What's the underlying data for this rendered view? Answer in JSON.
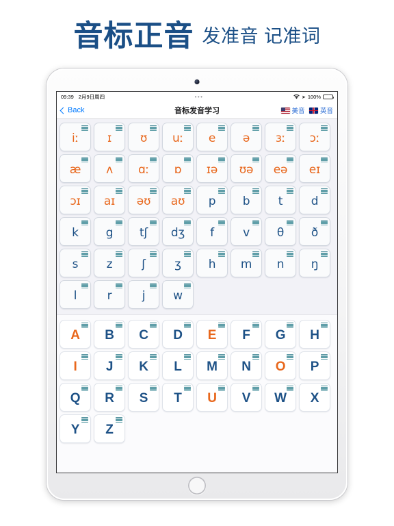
{
  "promo": {
    "main_title": "音标正音",
    "subtitle": "发准音 记准词"
  },
  "colors": {
    "brand_blue": "#1b4f86",
    "vowel_orange": "#e8671c",
    "consonant_blue": "#1d5186",
    "link_blue": "#007aff",
    "accent_blue": "#2b6cd4",
    "screen_bg": "#f2f2f7",
    "battery_green": "#34c759"
  },
  "status_bar": {
    "time": "09:39",
    "date": "2月9日周四",
    "multitask_dots": "•••",
    "wifi_icon": "wifi-icon",
    "location_icon": "location-icon",
    "battery_percent": "100%",
    "battery_icon": "battery-charging-icon"
  },
  "nav_bar": {
    "back_label": "Back",
    "back_icon": "chevron-left-icon",
    "title": "音标发音学习",
    "accents": [
      {
        "label": "美音",
        "flag": "us-flag-icon"
      },
      {
        "label": "英音",
        "flag": "uk-flag-icon"
      }
    ]
  },
  "phonetics": {
    "tile_icon": "list-icon",
    "rows": [
      [
        {
          "symbol": "iː",
          "type": "vowel"
        },
        {
          "symbol": "ɪ",
          "type": "vowel"
        },
        {
          "symbol": "ʊ",
          "type": "vowel"
        },
        {
          "symbol": "uː",
          "type": "vowel"
        },
        {
          "symbol": "e",
          "type": "vowel"
        },
        {
          "symbol": "ə",
          "type": "vowel"
        },
        {
          "symbol": "ɜː",
          "type": "vowel"
        },
        {
          "symbol": "ɔː",
          "type": "vowel"
        }
      ],
      [
        {
          "symbol": "æ",
          "type": "vowel"
        },
        {
          "symbol": "ʌ",
          "type": "vowel"
        },
        {
          "symbol": "ɑː",
          "type": "vowel"
        },
        {
          "symbol": "ɒ",
          "type": "vowel"
        },
        {
          "symbol": "ɪə",
          "type": "vowel"
        },
        {
          "symbol": "ʊə",
          "type": "vowel"
        },
        {
          "symbol": "eə",
          "type": "vowel"
        },
        {
          "symbol": "eɪ",
          "type": "vowel"
        }
      ],
      [
        {
          "symbol": "ɔɪ",
          "type": "vowel"
        },
        {
          "symbol": "aɪ",
          "type": "vowel"
        },
        {
          "symbol": "əʊ",
          "type": "vowel"
        },
        {
          "symbol": "aʊ",
          "type": "vowel"
        },
        {
          "symbol": "p",
          "type": "consonant"
        },
        {
          "symbol": "b",
          "type": "consonant"
        },
        {
          "symbol": "t",
          "type": "consonant"
        },
        {
          "symbol": "d",
          "type": "consonant"
        }
      ],
      [
        {
          "symbol": "k",
          "type": "consonant"
        },
        {
          "symbol": "g",
          "type": "consonant"
        },
        {
          "symbol": "tʃ",
          "type": "consonant"
        },
        {
          "symbol": "dʒ",
          "type": "consonant"
        },
        {
          "symbol": "f",
          "type": "consonant"
        },
        {
          "symbol": "v",
          "type": "consonant"
        },
        {
          "symbol": "θ",
          "type": "consonant"
        },
        {
          "symbol": "ð",
          "type": "consonant"
        }
      ],
      [
        {
          "symbol": "s",
          "type": "consonant"
        },
        {
          "symbol": "z",
          "type": "consonant"
        },
        {
          "symbol": "ʃ",
          "type": "consonant"
        },
        {
          "symbol": "ʒ",
          "type": "consonant"
        },
        {
          "symbol": "h",
          "type": "consonant"
        },
        {
          "symbol": "m",
          "type": "consonant"
        },
        {
          "symbol": "n",
          "type": "consonant"
        },
        {
          "symbol": "ŋ",
          "type": "consonant"
        }
      ],
      [
        {
          "symbol": "l",
          "type": "consonant"
        },
        {
          "symbol": "r",
          "type": "consonant"
        },
        {
          "symbol": "j",
          "type": "consonant"
        },
        {
          "symbol": "w",
          "type": "consonant"
        }
      ]
    ]
  },
  "alphabet": {
    "tile_icon": "list-icon",
    "rows": [
      [
        {
          "letter": "A",
          "type": "vowel"
        },
        {
          "letter": "B",
          "type": "consonant"
        },
        {
          "letter": "C",
          "type": "consonant"
        },
        {
          "letter": "D",
          "type": "consonant"
        },
        {
          "letter": "E",
          "type": "vowel"
        },
        {
          "letter": "F",
          "type": "consonant"
        },
        {
          "letter": "G",
          "type": "consonant"
        },
        {
          "letter": "H",
          "type": "consonant"
        }
      ],
      [
        {
          "letter": "I",
          "type": "vowel"
        },
        {
          "letter": "J",
          "type": "consonant"
        },
        {
          "letter": "K",
          "type": "consonant"
        },
        {
          "letter": "L",
          "type": "consonant"
        },
        {
          "letter": "M",
          "type": "consonant"
        },
        {
          "letter": "N",
          "type": "consonant"
        },
        {
          "letter": "O",
          "type": "vowel"
        },
        {
          "letter": "P",
          "type": "consonant"
        }
      ],
      [
        {
          "letter": "Q",
          "type": "consonant"
        },
        {
          "letter": "R",
          "type": "consonant"
        },
        {
          "letter": "S",
          "type": "consonant"
        },
        {
          "letter": "T",
          "type": "consonant"
        },
        {
          "letter": "U",
          "type": "vowel"
        },
        {
          "letter": "V",
          "type": "consonant"
        },
        {
          "letter": "W",
          "type": "consonant"
        },
        {
          "letter": "X",
          "type": "consonant"
        }
      ],
      [
        {
          "letter": "Y",
          "type": "consonant"
        },
        {
          "letter": "Z",
          "type": "consonant"
        }
      ]
    ]
  }
}
